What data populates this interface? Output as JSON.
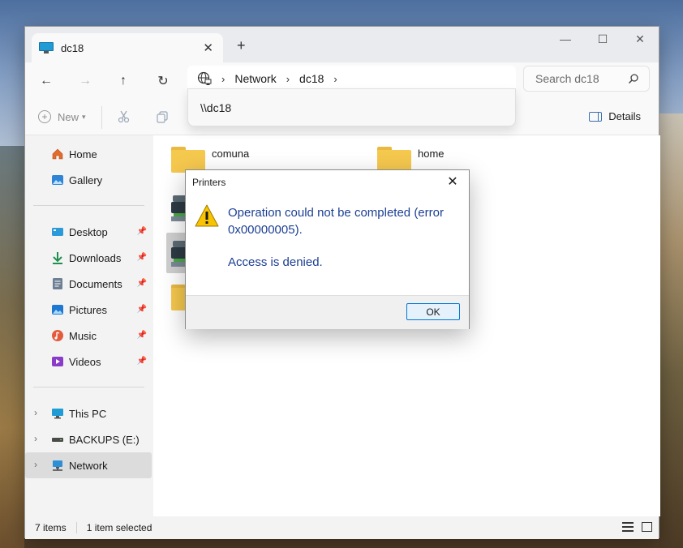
{
  "window": {
    "tab_title": "dc18",
    "close_glyph": "✕",
    "new_tab_glyph": "+",
    "controls": {
      "minimize": "—",
      "maximize": "☐",
      "close": "✕"
    }
  },
  "nav": {
    "back": "←",
    "forward": "→",
    "up": "↑",
    "refresh": "↻",
    "breadcrumbs": [
      "Network",
      "dc18"
    ],
    "chevron": "›",
    "search_placeholder": "Search dc18",
    "address_suggestion": "\\\\dc18"
  },
  "commandbar": {
    "new_label": "New",
    "details_label": "Details"
  },
  "sidebar": {
    "quick": [
      {
        "label": "Home"
      },
      {
        "label": "Gallery"
      }
    ],
    "pinned": [
      {
        "label": "Desktop"
      },
      {
        "label": "Downloads"
      },
      {
        "label": "Documents"
      },
      {
        "label": "Pictures"
      },
      {
        "label": "Music"
      },
      {
        "label": "Videos"
      }
    ],
    "locations": [
      {
        "label": "This PC"
      },
      {
        "label": "BACKUPS (E:)"
      },
      {
        "label": "Network"
      }
    ]
  },
  "content": {
    "items": [
      {
        "name": "comuna",
        "type": "folder"
      },
      {
        "name": "home",
        "type": "folder"
      }
    ]
  },
  "status": {
    "count": "7 items",
    "selection": "1 item selected"
  },
  "dialog": {
    "title": "Printers",
    "message": "Operation could not be completed (error 0x00000005).",
    "detail": "Access is denied.",
    "ok_label": "OK"
  },
  "colors": {
    "accent": "#0078d7",
    "dialog_text": "#1c3f94",
    "folder": "#f5c84e"
  }
}
